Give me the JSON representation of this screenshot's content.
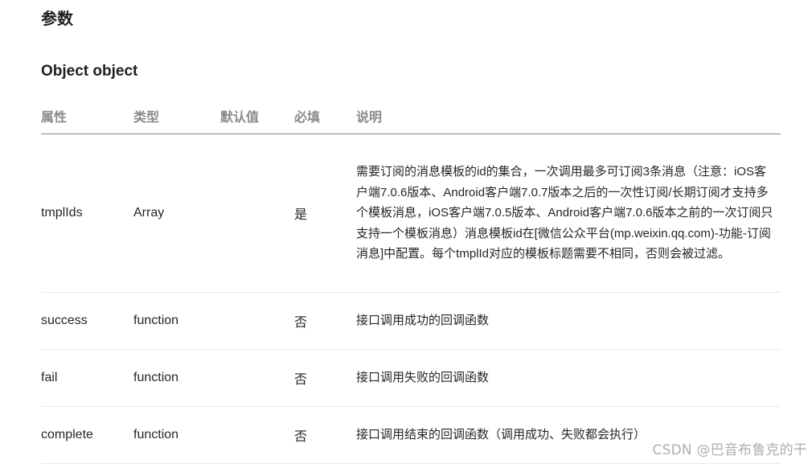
{
  "section_title": "参数",
  "sub_title": "Object object",
  "table": {
    "headers": {
      "prop": "属性",
      "type": "类型",
      "default": "默认值",
      "required": "必填",
      "desc": "说明"
    },
    "rows": [
      {
        "prop": "tmplIds",
        "type": "Array",
        "default": "",
        "required": "是",
        "desc": "需要订阅的消息模板的id的集合，一次调用最多可订阅3条消息（注意：iOS客户端7.0.6版本、Android客户端7.0.7版本之后的一次性订阅/长期订阅才支持多个模板消息，iOS客户端7.0.5版本、Android客户端7.0.6版本之前的一次订阅只支持一个模板消息）消息模板id在[微信公众平台(mp.weixin.qq.com)-功能-订阅消息]中配置。每个tmplId对应的模板标题需要不相同，否则会被过滤。"
      },
      {
        "prop": "success",
        "type": "function",
        "default": "",
        "required": "否",
        "desc": "接口调用成功的回调函数"
      },
      {
        "prop": "fail",
        "type": "function",
        "default": "",
        "required": "否",
        "desc": "接口调用失败的回调函数"
      },
      {
        "prop": "complete",
        "type": "function",
        "default": "",
        "required": "否",
        "desc": "接口调用结束的回调函数（调用成功、失败都会执行）"
      }
    ]
  },
  "watermark": "CSDN @巴音布鲁克的干"
}
